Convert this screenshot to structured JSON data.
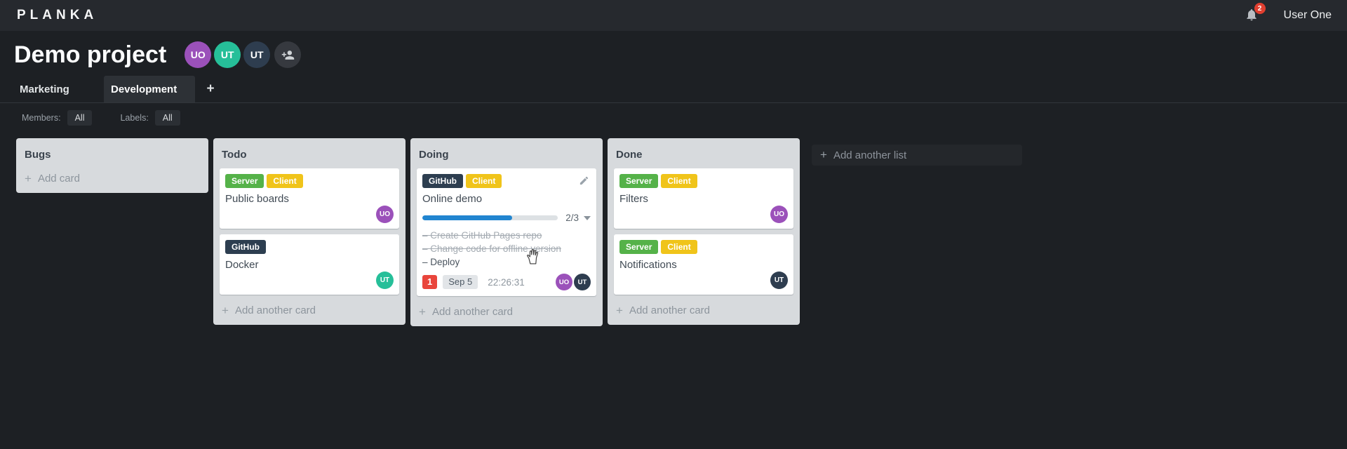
{
  "topbar": {
    "logo": "PLANKA",
    "notifications_count": "2",
    "user_name": "User One"
  },
  "project": {
    "title": "Demo project",
    "members": [
      {
        "initials": "UO",
        "color": "#9b51ba"
      },
      {
        "initials": "UT",
        "color": "#26bf99"
      },
      {
        "initials": "UT",
        "color": "#2e3d4f"
      }
    ]
  },
  "tabs": {
    "items": [
      {
        "label": "Marketing"
      },
      {
        "label": "Development"
      }
    ],
    "add_label": "+"
  },
  "filters": {
    "members_label": "Members:",
    "members_value": "All",
    "labels_label": "Labels:",
    "labels_value": "All"
  },
  "icons": {
    "plus": "+"
  },
  "board": {
    "add_list_label": "Add another list",
    "lists": [
      {
        "title": "Bugs",
        "add_card_label": "Add card",
        "cards": []
      },
      {
        "title": "Todo",
        "add_card_label": "Add another card",
        "cards": [
          {
            "title": "Public boards",
            "labels": [
              {
                "text": "Server",
                "color": "#55b249"
              },
              {
                "text": "Client",
                "color": "#f0c41a"
              }
            ],
            "members": [
              {
                "initials": "UO",
                "color": "#9b51ba"
              }
            ]
          },
          {
            "title": "Docker",
            "labels": [
              {
                "text": "GitHub",
                "color": "#2d3e50"
              }
            ],
            "members": [
              {
                "initials": "UT",
                "color": "#26bf99"
              }
            ]
          }
        ]
      },
      {
        "title": "Doing",
        "add_card_label": "Add another card",
        "cards": [
          {
            "title": "Online demo",
            "labels": [
              {
                "text": "GitHub",
                "color": "#2d3e50"
              },
              {
                "text": "Client",
                "color": "#f0c41a"
              }
            ],
            "progress": {
              "text": "2/3",
              "percent": "66%",
              "color": "#2185d0"
            },
            "tasks": [
              {
                "text": "– Create GitHub Pages repo",
                "done": true
              },
              {
                "text": "– Change code for offline version",
                "done": true
              },
              {
                "text": "– Deploy",
                "done": false
              }
            ],
            "notification_count": "1",
            "due_date": "Sep 5",
            "timer": "22:26:31",
            "members": [
              {
                "initials": "UO",
                "color": "#9b51ba"
              },
              {
                "initials": "UT",
                "color": "#2e3d4f"
              }
            ]
          }
        ]
      },
      {
        "title": "Done",
        "add_card_label": "Add another card",
        "cards": [
          {
            "title": "Filters",
            "labels": [
              {
                "text": "Server",
                "color": "#55b249"
              },
              {
                "text": "Client",
                "color": "#f0c41a"
              }
            ],
            "members": [
              {
                "initials": "UO",
                "color": "#9b51ba"
              }
            ]
          },
          {
            "title": "Notifications",
            "labels": [
              {
                "text": "Server",
                "color": "#55b249"
              },
              {
                "text": "Client",
                "color": "#f0c41a"
              }
            ],
            "members": [
              {
                "initials": "UT",
                "color": "#2e3d4f"
              }
            ]
          }
        ]
      }
    ]
  }
}
